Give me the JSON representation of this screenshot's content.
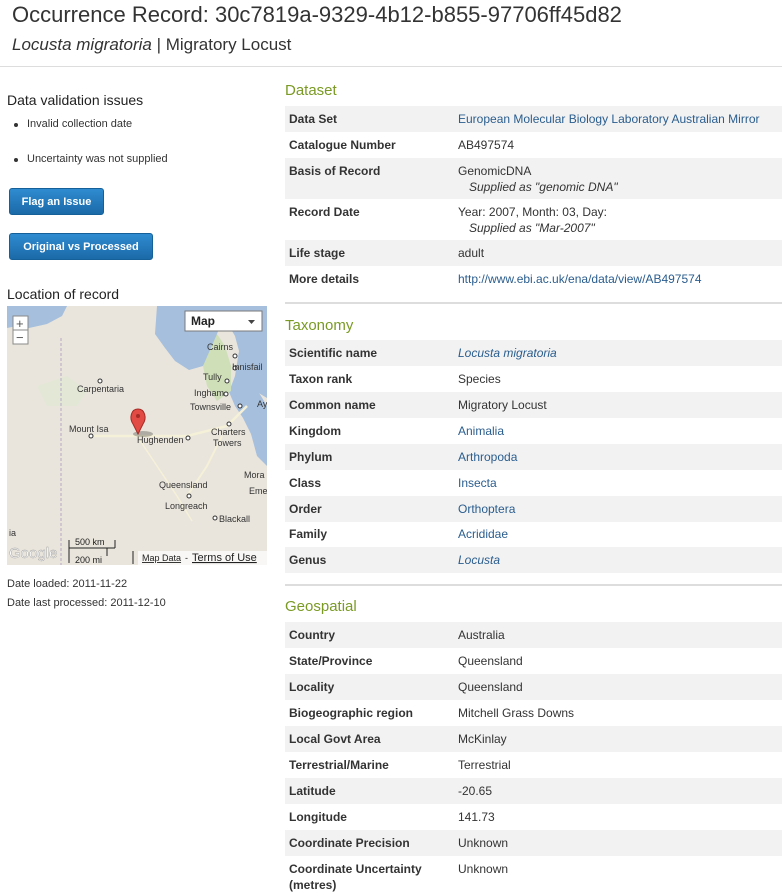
{
  "header": {
    "title": "Occurrence Record: 30c7819a-9329-4b12-b855-97706ff45d82",
    "scientific_name": "Locusta migratoria",
    "separator": " | ",
    "common_name": "Migratory Locust"
  },
  "validation": {
    "title": "Data validation issues",
    "issues": [
      "Invalid collection date",
      "Uncertainty was not supplied"
    ]
  },
  "buttons": {
    "flag": "Flag an Issue",
    "compare": "Original vs Processed"
  },
  "location": {
    "title": "Location of record",
    "map_type": "Map",
    "places": [
      "Cairns",
      "Innisfail",
      "Tully",
      "Ingham",
      "Townsville",
      "Ay",
      "Carpentaria",
      "Mount Isa",
      "Hughenden",
      "Charters",
      "Towers",
      "Mora",
      "Eme",
      "Queensland",
      "Longreach",
      "Blackall",
      "ia"
    ],
    "google": "Google",
    "scale_km": "500 km",
    "scale_mi": "200 mi",
    "map_data": "Map Data",
    "terms": "Terms of Use"
  },
  "dates": {
    "loaded": "Date loaded: 2011-11-22",
    "processed": "Date last processed: 2011-12-10"
  },
  "dataset": {
    "title": "Dataset",
    "rows": [
      {
        "k": "Data Set",
        "v": "European Molecular Biology Laboratory Australian Mirror"
      },
      {
        "k": "Catalogue Number",
        "v": "AB497574"
      },
      {
        "k": "Basis of Record",
        "v": "GenomicDNA",
        "s": "Supplied as \"genomic DNA\""
      },
      {
        "k": "Record Date",
        "v": "Year: 2007, Month: 03, Day:",
        "s": "Supplied as \"Mar-2007\""
      },
      {
        "k": "Life stage",
        "v": "adult"
      },
      {
        "k": "More details",
        "v": "http://www.ebi.ac.uk/ena/data/view/AB497574"
      }
    ]
  },
  "taxonomy": {
    "title": "Taxonomy",
    "rows": [
      {
        "k": "Scientific name",
        "v": "Locusta migratoria"
      },
      {
        "k": "Taxon rank",
        "v": "Species"
      },
      {
        "k": "Common name",
        "v": "Migratory Locust"
      },
      {
        "k": "Kingdom",
        "v": "Animalia"
      },
      {
        "k": "Phylum",
        "v": "Arthropoda"
      },
      {
        "k": "Class",
        "v": "Insecta"
      },
      {
        "k": "Order",
        "v": "Orthoptera"
      },
      {
        "k": "Family",
        "v": "Acrididae"
      },
      {
        "k": "Genus",
        "v": "Locusta"
      }
    ]
  },
  "geospatial": {
    "title": "Geospatial",
    "rows": [
      {
        "k": "Country",
        "v": "Australia"
      },
      {
        "k": "State/Province",
        "v": "Queensland"
      },
      {
        "k": "Locality",
        "v": "Queensland"
      },
      {
        "k": "Biogeographic region",
        "v": "Mitchell Grass Downs"
      },
      {
        "k": "Local Govt Area",
        "v": "McKinlay"
      },
      {
        "k": "Terrestrial/Marine",
        "v": "Terrestrial"
      },
      {
        "k": "Latitude",
        "v": "-20.65"
      },
      {
        "k": "Longitude",
        "v": "141.73"
      },
      {
        "k": "Coordinate Precision",
        "v": "Unknown"
      },
      {
        "k": "Coordinate Uncertainty (metres)",
        "v": "Unknown"
      }
    ]
  }
}
